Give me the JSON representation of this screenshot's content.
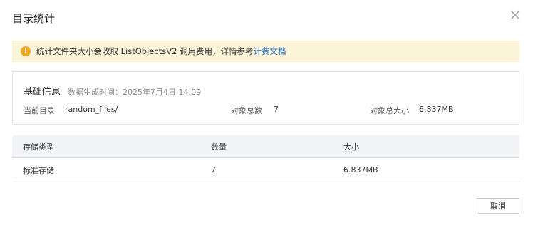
{
  "dialog": {
    "title": "目录统计",
    "close_icon": "close-icon"
  },
  "notice": {
    "icon": "warning-icon",
    "icon_glyph": "!",
    "text": "统计文件夹大小会收取 ListObjectsV2 调用费用，详情参考",
    "link_text": "计费文档"
  },
  "basic_info": {
    "title": "基础信息",
    "generated_time": "数据生成时间：2025年7月4日 14:09",
    "current_dir_label": "当前目录",
    "current_dir_value": "random_files/",
    "total_objects_label": "对象总数",
    "total_objects_value": "7",
    "total_size_label": "对象总大小",
    "total_size_value": "6.837MB"
  },
  "table": {
    "headers": [
      "存储类型",
      "数量",
      "大小"
    ],
    "rows": [
      [
        "标准存储",
        "7",
        "6.837MB"
      ]
    ]
  },
  "footer": {
    "cancel_label": "取消"
  },
  "colors": {
    "notice_bg": "#fdf5d9",
    "warning": "#f5a623",
    "link": "#1f6fd6",
    "table_header_bg": "#f2f4f7",
    "border": "#e3e3e3"
  }
}
